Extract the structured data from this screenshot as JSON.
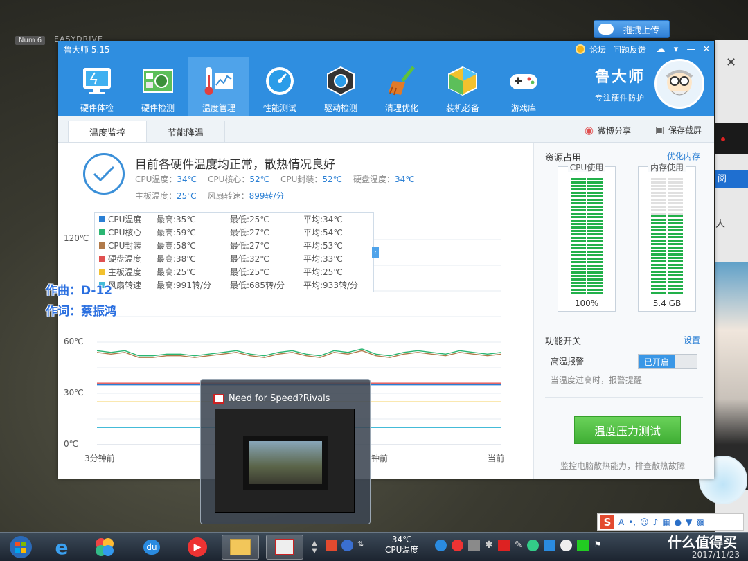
{
  "desktop": {
    "hud_badge": "Num 6",
    "hud_text": "EASYDRIVE",
    "lyric_composer": "作曲：D-12",
    "lyric_lyricist": "作词：蔡振鸿",
    "upload_button": "拖拽上传",
    "side_tab": "阅",
    "side_char": "人"
  },
  "window": {
    "title": "鲁大师 5.15",
    "links": [
      "论坛",
      "问题反馈"
    ],
    "brand_name": "鲁大师",
    "brand_sub": "专注硬件防护",
    "toolbar": [
      {
        "label": "硬件体检",
        "icon": "monitor-icon"
      },
      {
        "label": "硬件检测",
        "icon": "circuit-board-icon"
      },
      {
        "label": "温度管理",
        "icon": "thermometer-icon",
        "active": true
      },
      {
        "label": "性能测试",
        "icon": "speedometer-icon"
      },
      {
        "label": "驱动检测",
        "icon": "gear-cube-icon"
      },
      {
        "label": "清理优化",
        "icon": "broom-icon"
      },
      {
        "label": "装机必备",
        "icon": "box-icon"
      },
      {
        "label": "游戏库",
        "icon": "gamepad-icon"
      }
    ],
    "tabs": [
      "温度监控",
      "节能降温"
    ],
    "share_label": "微博分享",
    "save_label": "保存截屏"
  },
  "status": {
    "title": "目前各硬件温度均正常，散热情况良好",
    "line1": [
      {
        "label": "CPU温度：",
        "value": "34℃"
      },
      {
        "label": "CPU核心：",
        "value": "52℃"
      },
      {
        "label": "CPU封装：",
        "value": "52℃"
      },
      {
        "label": "硬盘温度：",
        "value": "34℃"
      }
    ],
    "line2": [
      {
        "label": "主板温度：",
        "value": "25℃"
      },
      {
        "label": "风扇转速：",
        "value": "899转/分"
      }
    ]
  },
  "legend": [
    {
      "name": "CPU温度",
      "max": "最高:35℃",
      "min": "最低:25℃",
      "avg": "平均:34℃",
      "color": "#2a7fd4"
    },
    {
      "name": "CPU核心",
      "max": "最高:59℃",
      "min": "最低:27℃",
      "avg": "平均:54℃",
      "color": "#2bb673"
    },
    {
      "name": "CPU封装",
      "max": "最高:58℃",
      "min": "最低:27℃",
      "avg": "平均:53℃",
      "color": "#b07a4a"
    },
    {
      "name": "硬盘温度",
      "max": "最高:38℃",
      "min": "最低:32℃",
      "avg": "平均:33℃",
      "color": "#e05050"
    },
    {
      "name": "主板温度",
      "max": "最高:25℃",
      "min": "最低:25℃",
      "avg": "平均:25℃",
      "color": "#f2c12e"
    },
    {
      "name": "风扇转速",
      "max": "最高:991转/分",
      "min": "最低:685转/分",
      "avg": "平均:933转/分",
      "color": "#44bbd8"
    }
  ],
  "chart_data": {
    "type": "line",
    "y_ticks": [
      "120℃",
      "60℃",
      "30℃",
      "0℃"
    ],
    "x_ticks": [
      "3分钟前",
      "钟前",
      "当前"
    ],
    "series": [
      {
        "name": "CPU核心",
        "color": "#2bb673",
        "values": [
          55,
          54,
          55,
          52,
          52,
          53,
          53,
          52,
          53,
          54,
          55,
          53,
          52,
          54,
          55,
          53,
          52,
          55,
          54,
          56,
          53,
          52,
          54,
          55,
          54,
          53,
          55,
          54,
          53,
          54
        ]
      },
      {
        "name": "CPU封装",
        "color": "#b07a4a",
        "values": [
          54,
          53,
          54,
          51,
          51,
          52,
          52,
          51,
          52,
          53,
          54,
          52,
          51,
          53,
          54,
          52,
          51,
          54,
          53,
          55,
          52,
          51,
          53,
          54,
          53,
          52,
          54,
          53,
          52,
          53
        ]
      },
      {
        "name": "硬盘温度",
        "color": "#e05050",
        "values": [
          36,
          36,
          36,
          36,
          36,
          36,
          36,
          36,
          36,
          36,
          36,
          36,
          36,
          36,
          36,
          36,
          36,
          36,
          36,
          36,
          36,
          36,
          36,
          36,
          36,
          36,
          36,
          36,
          36,
          36
        ]
      },
      {
        "name": "CPU温度",
        "color": "#2a7fd4",
        "values": [
          35,
          35,
          35,
          35,
          35,
          35,
          35,
          35,
          35,
          35,
          35,
          35,
          35,
          35,
          35,
          35,
          35,
          35,
          35,
          35,
          35,
          35,
          35,
          35,
          35,
          35,
          35,
          35,
          35,
          35
        ]
      },
      {
        "name": "主板温度",
        "color": "#f2c12e",
        "values": [
          25,
          25,
          25,
          25,
          25,
          25,
          25,
          25,
          25,
          25,
          25,
          25,
          25,
          25,
          25,
          25,
          25,
          25,
          25,
          25,
          25,
          25,
          25,
          25,
          25,
          25,
          25,
          25,
          25,
          25
        ]
      },
      {
        "name": "风扇转速",
        "color": "#44bbd8",
        "values": [
          10,
          10,
          10,
          10,
          10,
          10,
          10,
          10,
          10,
          10,
          10,
          10,
          10,
          10,
          10,
          10,
          10,
          10,
          10,
          10,
          10,
          10,
          10,
          10,
          10,
          10,
          10,
          10,
          10,
          10
        ]
      }
    ],
    "ylim": [
      0,
      120
    ]
  },
  "resources": {
    "title": "资源占用",
    "optimize_link": "优化内存",
    "cpu_label": "CPU使用",
    "cpu_value": "100%",
    "cpu_level": 1.0,
    "mem_label": "内存使用",
    "mem_value": "5.4 GB",
    "mem_level": 0.68
  },
  "functions": {
    "title": "功能开关",
    "settings_link": "设置",
    "alarm_label": "高温报警",
    "toggle_on": "已开启",
    "alarm_desc": "当温度过高时，报警提醒",
    "stress_button": "温度压力测试",
    "stress_desc": "监控电脑散热能力，排查散热故障"
  },
  "thumbnail": {
    "title": "Need for Speed?Rivals"
  },
  "taskbar": {
    "clock_temp": "34℃",
    "clock_label": "CPU温度",
    "date": "2017/11/23",
    "watermark": "什么值得买"
  }
}
